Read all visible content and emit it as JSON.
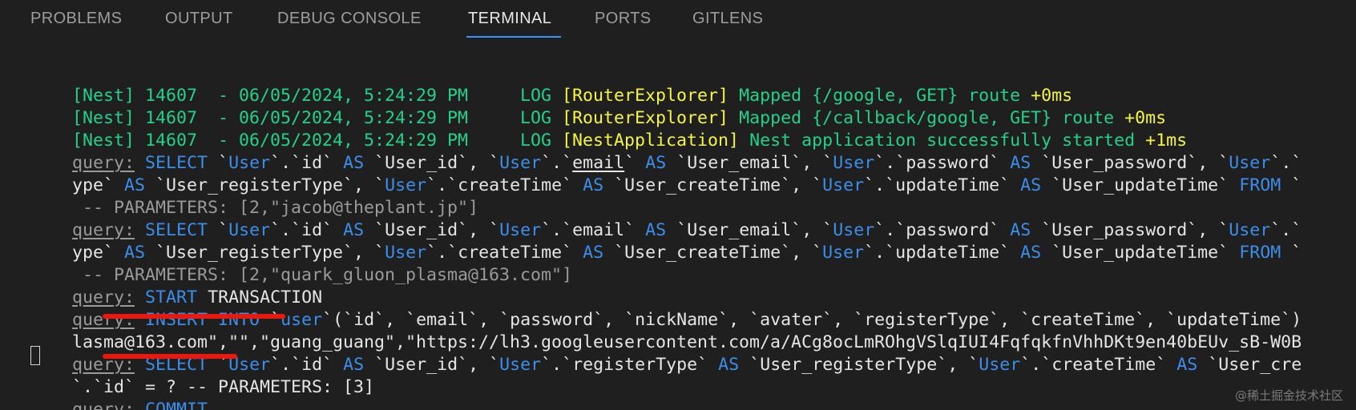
{
  "tabs": [
    {
      "label": "PROBLEMS"
    },
    {
      "label": "OUTPUT"
    },
    {
      "label": "DEBUG CONSOLE"
    },
    {
      "label": "TERMINAL",
      "active": true
    },
    {
      "label": "PORTS"
    },
    {
      "label": "GITLENS"
    }
  ],
  "colors": {
    "background": "#1f1f1f",
    "green": "#23d18b",
    "yellow": "#f5f543",
    "blue": "#3b8eea",
    "tab_active_underline": "#3794ff",
    "annotation_red": "#e8190e"
  },
  "terminal": {
    "nest_logs": [
      {
        "prefix": "[Nest] 14607  - 06/05/2024, 5:24:29 PM     LOG ",
        "context": "[RouterExplorer]",
        "message": " Mapped {/google, GET} route ",
        "timing": "+0ms"
      },
      {
        "prefix": "[Nest] 14607  - 06/05/2024, 5:24:29 PM     LOG ",
        "context": "[RouterExplorer]",
        "message": " Mapped {/callback/google, GET} route ",
        "timing": "+0ms"
      },
      {
        "prefix": "[Nest] 14607  - 06/05/2024, 5:24:29 PM     LOG ",
        "context": "[NestApplication]",
        "message": " Nest application successfully started ",
        "timing": "+1ms"
      }
    ],
    "query_label": "query:",
    "q1": {
      "line1": [
        " ",
        "SELECT",
        " `",
        "User",
        "`.`id` ",
        "AS",
        " `User_id`, `",
        "User",
        "`.`",
        "email",
        "` ",
        "AS",
        " `User_email`, `",
        "User",
        "`.`password` ",
        "AS",
        " `User_password`, `",
        "User",
        "`.`"
      ],
      "line2": [
        "ype` ",
        "AS",
        " `User_registerType`, `",
        "User",
        "`.`createTime` ",
        "AS",
        " `User_createTime`, `",
        "User",
        "`.`updateTime` ",
        "AS",
        " `User_updateTime` ",
        "FROM",
        " `"
      ],
      "params": " -- PARAMETERS: [2,\"jacob@theplant.jp\"]"
    },
    "q2": {
      "line1": [
        " ",
        "SELECT",
        " `",
        "User",
        "`.`id` ",
        "AS",
        " `User_id`, `",
        "User",
        "`.`email` ",
        "AS",
        " `User_email`, `",
        "User",
        "`.`password` ",
        "AS",
        " `User_password`, `",
        "User",
        "`.`"
      ],
      "line2": [
        "ype` ",
        "AS",
        " `User_registerType`, `",
        "User",
        "`.`createTime` ",
        "AS",
        " `User_createTime`, `",
        "User",
        "`.`updateTime` ",
        "AS",
        " `User_updateTime` ",
        "FROM",
        " `"
      ],
      "params": " -- PARAMETERS: [2,\"quark_gluon_plasma@163.com\"]"
    },
    "q3": {
      "line": [
        " ",
        "START",
        " TRANSACTION"
      ]
    },
    "q4": {
      "line1": [
        " ",
        "INSERT INTO",
        " `",
        "user",
        "`(`id`, `email`, `password`, `nickName`, `avater`, `registerType`, `createTime`, `updateTime`)"
      ],
      "line2": "lasma@163.com\",\"\",\"guang_guang\",\"https://lh3.googleusercontent.com/a/ACg8ocLmROhgVSlqIUI4FqfqkfnVhhDKt9en40bEUv_sB-W0B"
    },
    "q5": {
      "line1": [
        " ",
        "SELECT",
        " `",
        "User",
        "`.`id` ",
        "AS",
        " `User_id`, `",
        "User",
        "`.`registerType` ",
        "AS",
        " `User_registerType`, `",
        "User",
        "`.`createTime` ",
        "AS",
        " `User_cre"
      ],
      "line2": "`.`id` = ? -- PARAMETERS: [3]"
    },
    "q6": {
      "line": [
        " ",
        "COMMIT"
      ]
    }
  },
  "watermark": "@稀土掘金技术社区"
}
